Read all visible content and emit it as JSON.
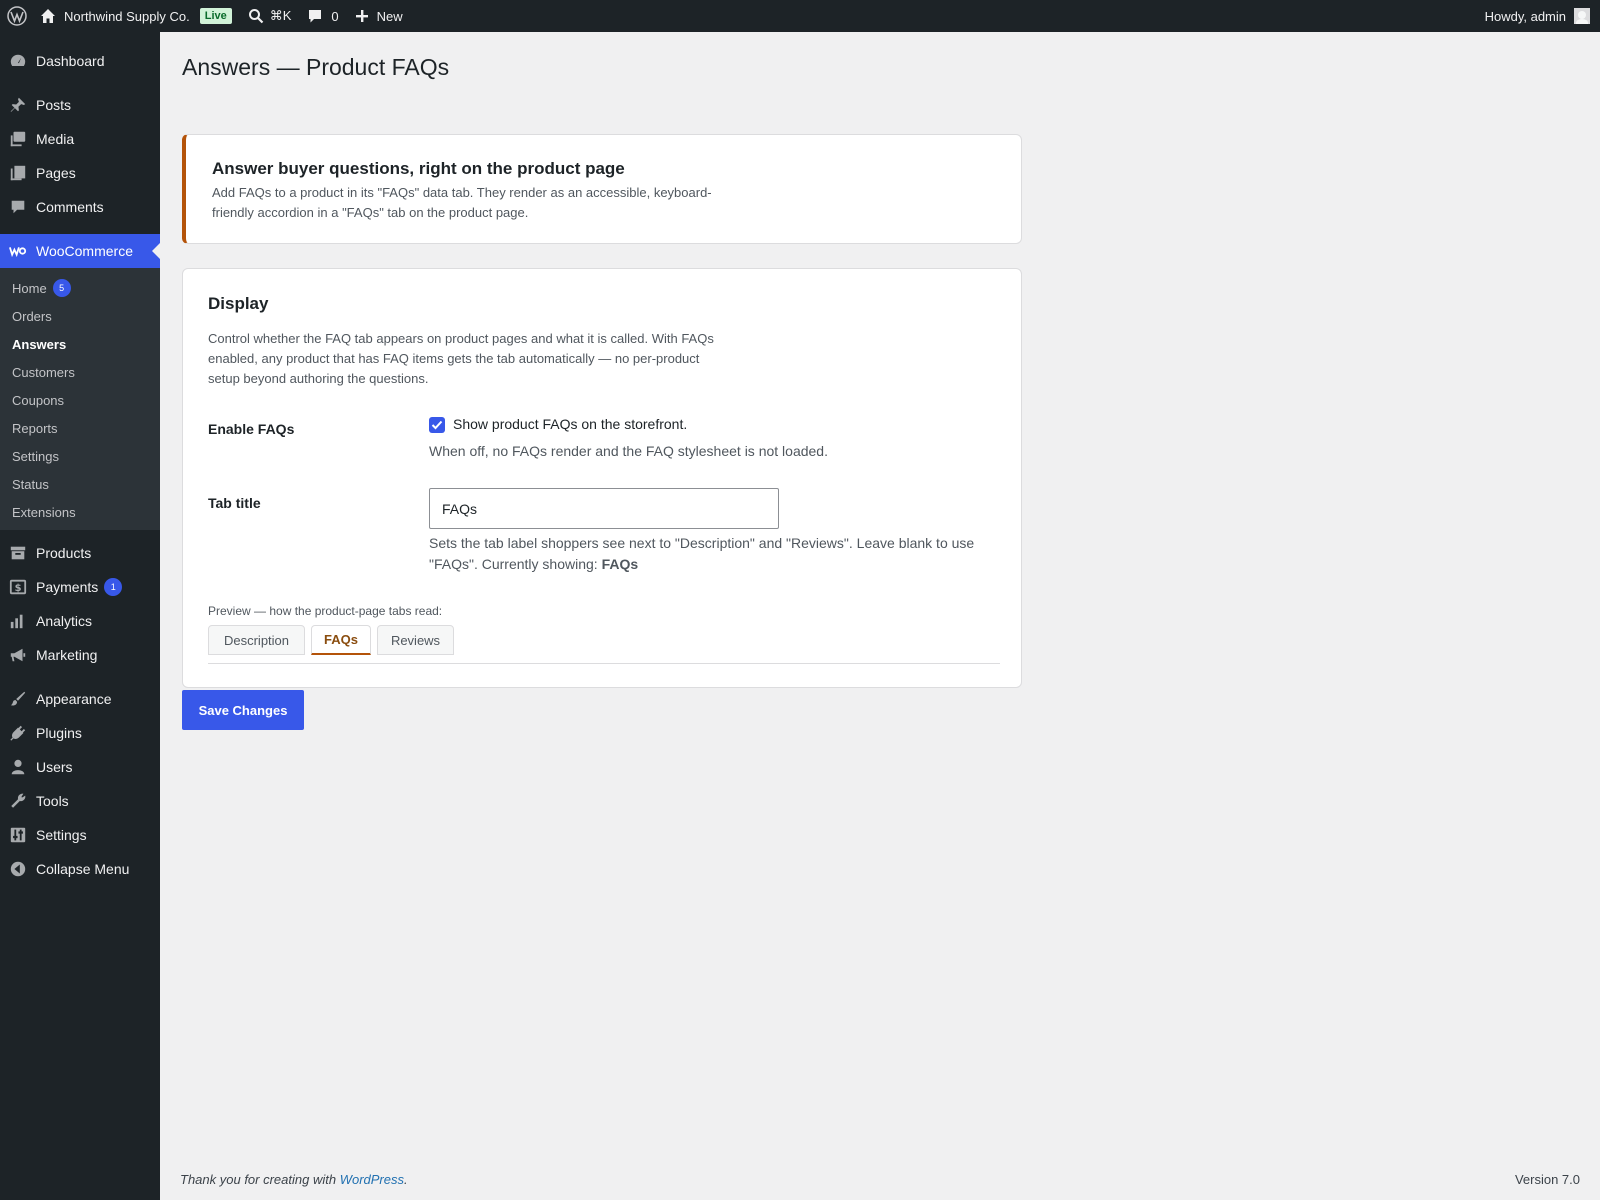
{
  "admin_bar": {
    "site_name": "Northwind Supply Co.",
    "live_badge": "Live",
    "search_shortcut": "⌘K",
    "comments_count": "0",
    "new_label": "New",
    "greeting": "Howdy, admin"
  },
  "sidebar": {
    "items": [
      {
        "label": "Dashboard",
        "icon": "dashboard-icon"
      },
      {
        "label": "Posts",
        "icon": "pin-icon"
      },
      {
        "label": "Media",
        "icon": "media-icon"
      },
      {
        "label": "Pages",
        "icon": "pages-icon"
      },
      {
        "label": "Comments",
        "icon": "comment-icon"
      },
      {
        "label": "WooCommerce",
        "icon": "woo-icon"
      },
      {
        "label": "Products",
        "icon": "archive-icon"
      },
      {
        "label": "Payments",
        "icon": "dollar-icon",
        "badge": "1"
      },
      {
        "label": "Analytics",
        "icon": "chart-icon"
      },
      {
        "label": "Marketing",
        "icon": "megaphone-icon"
      },
      {
        "label": "Appearance",
        "icon": "brush-icon"
      },
      {
        "label": "Plugins",
        "icon": "plug-icon"
      },
      {
        "label": "Users",
        "icon": "user-icon"
      },
      {
        "label": "Tools",
        "icon": "wrench-icon"
      },
      {
        "label": "Settings",
        "icon": "sliders-icon"
      },
      {
        "label": "Collapse Menu",
        "icon": "collapse-icon"
      }
    ],
    "submenu": [
      {
        "label": "Home",
        "badge": "5"
      },
      {
        "label": "Orders"
      },
      {
        "label": "Answers"
      },
      {
        "label": "Customers"
      },
      {
        "label": "Coupons"
      },
      {
        "label": "Reports"
      },
      {
        "label": "Settings"
      },
      {
        "label": "Status"
      },
      {
        "label": "Extensions"
      }
    ]
  },
  "page": {
    "title": "Answers — Product FAQs",
    "notice": {
      "heading": "Answer buyer questions, right on the product page",
      "text": "Add FAQs to a product in its \"FAQs\" data tab. They render as an accessible, keyboard-friendly accordion in a \"FAQs\" tab on the product page."
    },
    "display": {
      "heading": "Display",
      "description": "Control whether the FAQ tab appears on product pages and what it is called. With FAQs enabled, any product that has FAQ items gets the tab automatically — no per-product setup beyond authoring the questions.",
      "enable_label": "Enable FAQs",
      "enable_checked": true,
      "enable_checkbox_label": "Show product FAQs on the storefront.",
      "enable_help": "When off, no FAQs render and the FAQ stylesheet is not loaded.",
      "tab_title_label": "Tab title",
      "tab_title_value": "FAQs",
      "tab_title_help_prefix": "Sets the tab label shoppers see next to \"Description\" and \"Reviews\". Leave blank to use \"FAQs\". Currently showing: ",
      "tab_title_current": "FAQs",
      "preview_label": "Preview — how the product-page tabs read:",
      "preview_tabs": [
        "Description",
        "FAQs",
        "Reviews"
      ],
      "preview_active_tab": "FAQs"
    },
    "save_label": "Save Changes"
  },
  "footer": {
    "thanks_prefix": "Thank you for creating with ",
    "thanks_link": "WordPress",
    "thanks_suffix": ".",
    "version": "Version 7.0"
  },
  "colors": {
    "admin_bg": "#1d2327",
    "accent": "#3858e9",
    "notice_border": "#b45309"
  }
}
